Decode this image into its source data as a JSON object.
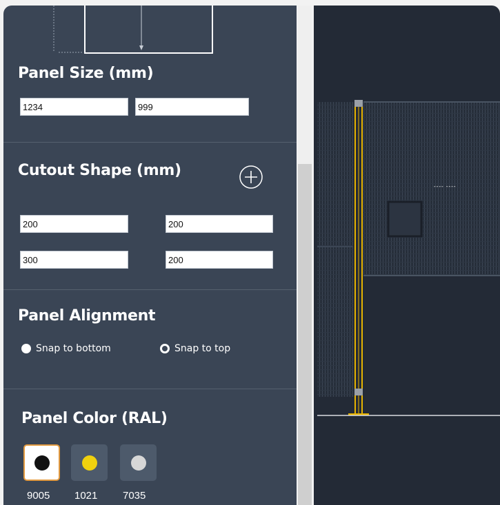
{
  "panel_size": {
    "title": "Panel Size (mm)",
    "width_value": "1234",
    "height_value": "999"
  },
  "cutout": {
    "title": "Cutout Shape (mm)",
    "rows": [
      {
        "a": "200",
        "b": "200"
      },
      {
        "a": "300",
        "b": "200"
      }
    ]
  },
  "alignment": {
    "title": "Panel Alignment",
    "options": [
      {
        "label": "Snap to bottom",
        "selected": true
      },
      {
        "label": "Snap to top",
        "selected": false
      }
    ]
  },
  "color": {
    "title": "Panel Color (RAL)",
    "swatches": [
      {
        "code": "9005",
        "color": "#111111",
        "selected": true
      },
      {
        "code": "1021",
        "color": "#f0d10e",
        "selected": false
      },
      {
        "code": "7035",
        "color": "#d7d7d7",
        "selected": false
      }
    ]
  },
  "preview": {
    "dimension_label": "---- ----"
  },
  "colors": {
    "sidebar_bg": "#3a4555",
    "canvas_bg": "#232a36",
    "accent_selected": "#e39a3f",
    "post_color": "#e8b400"
  }
}
